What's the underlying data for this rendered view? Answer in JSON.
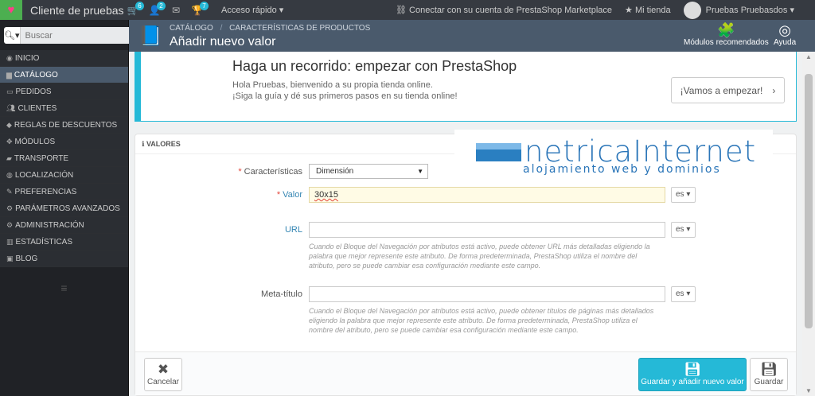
{
  "topbar": {
    "shop_name": "Cliente de pruebas",
    "orders_badge": "6",
    "customers_badge": "2",
    "messages_badge": "",
    "trophy_badge": "7",
    "quick_access": "Acceso rápido",
    "marketplace": "Conectar con su cuenta de PrestaShop Marketplace",
    "my_shop": "Mi tienda",
    "user": "Pruebas Pruebasdos"
  },
  "sidebar": {
    "search_placeholder": "Buscar",
    "items": [
      {
        "label": "Inicio",
        "icon": "dashboard-icon"
      },
      {
        "label": "Catálogo",
        "icon": "book-icon"
      },
      {
        "label": "Pedidos",
        "icon": "credit-card-icon"
      },
      {
        "label": "Clientes",
        "icon": "users-icon"
      },
      {
        "label": "Reglas de descuentos",
        "icon": "tag-icon"
      },
      {
        "label": "Módulos",
        "icon": "puzzle-icon"
      },
      {
        "label": "Transporte",
        "icon": "truck-icon"
      },
      {
        "label": "Localización",
        "icon": "globe-icon"
      },
      {
        "label": "Preferencias",
        "icon": "wrench-icon"
      },
      {
        "label": "Parámetros avanzados",
        "icon": "cogs-icon"
      },
      {
        "label": "Administración",
        "icon": "gear-icon"
      },
      {
        "label": "Estadísticas",
        "icon": "chart-icon"
      },
      {
        "label": "Blog",
        "icon": "blog-icon"
      }
    ]
  },
  "header": {
    "breadcrumb_1": "Catálogo",
    "breadcrumb_sep": "/",
    "breadcrumb_2": "Características de productos",
    "title": "Añadir nuevo valor",
    "modules_label": "Módulos recomendados",
    "help_label": "Ayuda"
  },
  "tour": {
    "title": "Haga un recorrido: empezar con PrestaShop",
    "line1": "Hola Pruebas, bienvenido a su propia tienda online.",
    "line2": "¡Siga la guía y dé sus primeros pasos en su tienda online!",
    "button": "¡Vamos a empezar!"
  },
  "form": {
    "panel_title": "Valores",
    "feature_label": "Características",
    "feature_value": "Dimensión",
    "value_label": "Valor",
    "value_value": "30x15",
    "url_label": "URL",
    "url_value": "",
    "meta_label": "Meta-título",
    "meta_value": "",
    "lang": "es",
    "url_help": "Cuando el Bloque del Navegación por atributos está activo, puede obtener URL más detalladas eligiendo la palabra que mejor represente este atributo. De forma predeterminada, PrestaShop utiliza el nombre del atributo, pero se puede cambiar esa configuración mediante este campo.",
    "meta_help": "Cuando el Bloque del Navegación por atributos está activo, puede obtener títulos de páginas más detallados eligiendo la palabra que mejor represente este atributo. De forma predeterminada, PrestaShop utiliza el nombre del atributo, pero se puede cambiar esa configuración mediante este campo."
  },
  "footer": {
    "cancel": "Cancelar",
    "save_add": "Guardar y añadir nuevo valor",
    "save": "Guardar"
  },
  "watermark": {
    "name": "netricaInternet",
    "sub": "alojamiento web y dominios"
  }
}
